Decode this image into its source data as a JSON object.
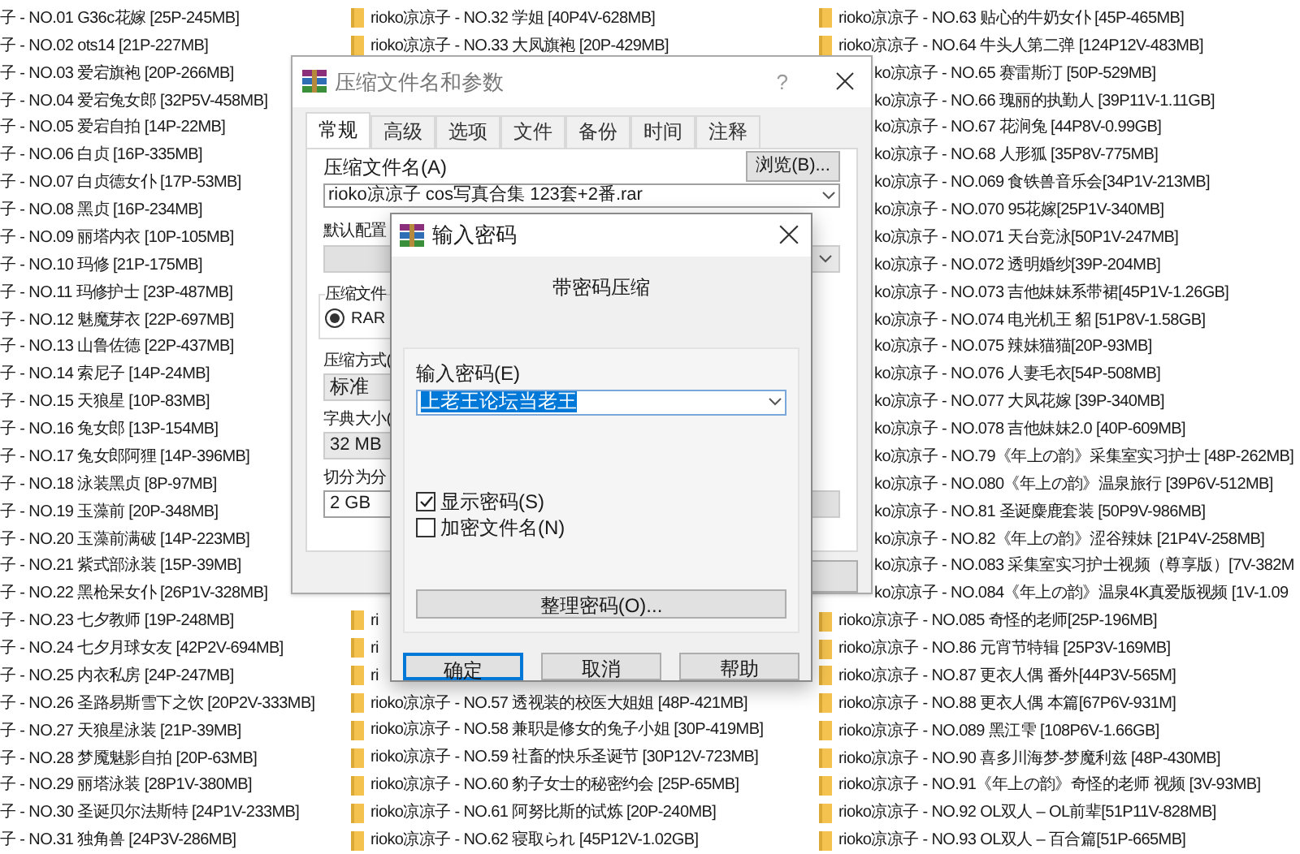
{
  "file_list": {
    "column_1": [
      "子 - NO.01 G36c花嫁 [25P-245MB]",
      "子 - NO.02 ots14 [21P-227MB]",
      "子 - NO.03 爱宕旗袍 [20P-266MB]",
      "子 - NO.04 爱宕兔女郎 [32P5V-458MB]",
      "子 - NO.05 爱宕自拍 [14P-22MB]",
      "子 - NO.06 白贞 [16P-335MB]",
      "子 - NO.07 白贞德女仆 [17P-53MB]",
      "子 - NO.08 黑贞 [16P-234MB]",
      "子 - NO.09 丽塔内衣 [10P-105MB]",
      "子 - NO.10 玛修 [21P-175MB]",
      "子 - NO.11 玛修护士 [23P-487MB]",
      "子 - NO.12 魅魔芽衣 [22P-697MB]",
      "子 - NO.13 山鲁佐德 [22P-437MB]",
      "子 - NO.14 索尼子 [14P-24MB]",
      "子 - NO.15 天狼星 [10P-83MB]",
      "子 - NO.16 兔女郎 [13P-154MB]",
      "子 - NO.17 兔女郎阿狸 [14P-396MB]",
      "子 - NO.18 泳装黑贞 [8P-97MB]",
      "子 - NO.19 玉藻前 [20P-348MB]",
      "子 - NO.20 玉藻前满破 [14P-223MB]",
      "子 - NO.21 紫式部泳装 [15P-39MB]",
      "子 - NO.22 黑枪呆女仆 [26P1V-328MB]",
      "子 - NO.23 七夕教师 [19P-248MB]",
      "子 - NO.24 七夕月球女友 [42P2V-694MB]",
      "子 - NO.25 内衣私房 [24P-247MB]",
      "子 - NO.26 圣路易斯雪下之饮 [20P2V-333MB]",
      "子 - NO.27 天狼星泳装 [21P-39MB]",
      "子 - NO.28 梦魇魅影自拍 [20P-63MB]",
      "子 - NO.29 丽塔泳装 [28P1V-380MB]",
      "子 - NO.30 圣诞贝尔法斯特 [24P1V-233MB]",
      "子 - NO.31 独角兽 [24P3V-286MB]"
    ],
    "column_2": {
      "top": [
        "rioko凉凉子 - NO.32 学姐 [40P4V-628MB]",
        "rioko凉凉子 - NO.33 大凤旗袍 [20P-429MB]"
      ],
      "bottom": [
        "ri",
        "ri",
        "ri",
        "rioko凉凉子 - NO.57 透视装的校医大姐姐 [48P-421MB]",
        "rioko凉凉子 - NO.58 兼职是修女的兔子小姐 [30P-419MB]",
        "rioko凉凉子 - NO.59 社畜的快乐圣诞节 [30P12V-723MB]",
        "rioko凉凉子 - NO.60 豹子女士的秘密约会 [25P-65MB]",
        "rioko凉凉子 - NO.61 阿努比斯的试炼 [20P-240MB]",
        "rioko凉凉子 - NO.62 寝取られ [45P12V-1.02GB]"
      ]
    },
    "column_3": [
      {
        "kind": "full",
        "name": "rioko凉凉子 - NO.63 贴心的牛奶女仆 [45P-465MB]"
      },
      {
        "kind": "full",
        "name": "rioko凉凉子 - NO.64 牛头人第二弹 [124P12V-483MB]"
      },
      {
        "kind": "cut",
        "name": "ko凉凉子 - NO.65 赛雷斯汀 [50P-529MB]"
      },
      {
        "kind": "cut",
        "name": "ko凉凉子 - NO.66 瑰丽的执勤人 [39P11V-1.11GB]"
      },
      {
        "kind": "cut",
        "name": "ko凉凉子 - NO.67 花涧兔 [44P8V-0.99GB]"
      },
      {
        "kind": "cut",
        "name": "ko凉凉子 - NO.68 人形狐 [35P8V-775MB]"
      },
      {
        "kind": "cut",
        "name": "ko凉凉子 - NO.069 食铁兽音乐会[34P1V-213MB]"
      },
      {
        "kind": "cut",
        "name": "ko凉凉子 - NO.070 95花嫁[25P1V-340MB]"
      },
      {
        "kind": "cut",
        "name": "ko凉凉子 - NO.071 天台竞泳[50P1V-247MB]"
      },
      {
        "kind": "cut",
        "name": "ko凉凉子 - NO.072 透明婚纱[39P-204MB]"
      },
      {
        "kind": "cut",
        "name": "ko凉凉子 - NO.073 吉他妹妹系带裙[45P1V-1.26GB]"
      },
      {
        "kind": "cut",
        "name": "ko凉凉子 - NO.074 电光机王 貂 [51P8V-1.58GB]"
      },
      {
        "kind": "cut",
        "name": "ko凉凉子 - NO.075 辣妹猫猫[20P-93MB]"
      },
      {
        "kind": "cut",
        "name": "ko凉凉子 - NO.076 人妻毛衣[54P-508MB]"
      },
      {
        "kind": "cut",
        "name": "ko凉凉子 - NO.077 大凤花嫁 [39P-340MB]"
      },
      {
        "kind": "cut",
        "name": "ko凉凉子 - NO.078 吉他妹妹2.0 [40P-609MB]"
      },
      {
        "kind": "cut",
        "name": "ko凉凉子 - NO.79《年上の韵》采集室实习护士 [48P-262MB]"
      },
      {
        "kind": "cut",
        "name": "ko凉凉子 - NO.080《年上の韵》温泉旅行 [39P6V-512MB]"
      },
      {
        "kind": "cut",
        "name": "ko凉凉子 - NO.81 圣诞麋鹿套装 [50P9V-986MB]"
      },
      {
        "kind": "cut",
        "name": "ko凉凉子 - NO.82《年上の韵》涩谷辣妹 [21P4V-258MB]"
      },
      {
        "kind": "cut",
        "name": "ko凉凉子 - NO.083 采集室实习护士视频（尊享版）[7V-382M"
      },
      {
        "kind": "cut",
        "name": "ko凉凉子 - NO.084《年上の韵》温泉4K真爱版视频 [1V-1.09"
      },
      {
        "kind": "full",
        "name": "rioko凉凉子 - NO.085 奇怪的老师[25P-196MB]"
      },
      {
        "kind": "full",
        "name": "rioko凉凉子 - NO.86 元宵节特辑 [25P3V-169MB]"
      },
      {
        "kind": "full",
        "name": "rioko凉凉子 - NO.87 更衣人偶 番外[44P3V-565M]"
      },
      {
        "kind": "full",
        "name": "rioko凉凉子 - NO.88 更衣人偶 本篇[67P6V-931M]"
      },
      {
        "kind": "full",
        "name": "rioko凉凉子 - NO.089 黑江雫 [108P6V-1.66GB]"
      },
      {
        "kind": "full",
        "name": "rioko凉凉子 - NO.90 喜多川海梦-梦魔利兹 [48P-430MB]"
      },
      {
        "kind": "full",
        "name": "rioko凉凉子 - NO.91《年上の韵》奇怪的老师 视频 [3V-93MB]"
      },
      {
        "kind": "full",
        "name": "rioko凉凉子 - NO.92 OL双人 – OL前辈[51P11V-828MB]"
      },
      {
        "kind": "full",
        "name": "rioko凉凉子 - NO.93 OL双人 – 百合篇[51P-665MB]"
      }
    ]
  },
  "archive_dialog": {
    "title": "压缩文件名和参数",
    "help_mark": "?",
    "tabs": [
      {
        "label": "常规",
        "selected": true
      },
      {
        "label": "高级",
        "selected": false
      },
      {
        "label": "选项",
        "selected": false
      },
      {
        "label": "文件",
        "selected": false
      },
      {
        "label": "备份",
        "selected": false
      },
      {
        "label": "时间",
        "selected": false
      },
      {
        "label": "注释",
        "selected": false
      }
    ],
    "archive_name_label": "压缩文件名(A)",
    "browse_button": "浏览(B)...",
    "archive_name": "rioko凉凉子 cos写真合集 123套+2番.rar",
    "profile_label": "默认配置",
    "format_group_label": "压缩文件",
    "format_option": {
      "label": "RAR",
      "selected": true
    },
    "method_label": "压缩方式(",
    "method": "标准",
    "dictionary_label": "字典大小(",
    "dictionary": "32 MB",
    "split_label": "切分为分",
    "split": "2 GB"
  },
  "password_dialog": {
    "title": "输入密码",
    "heading": "带密码压缩",
    "password_label": "输入密码(E)",
    "password": "上老王论坛当老王",
    "password_selected": true,
    "options": [
      {
        "label": "显示密码(S)",
        "checked": true
      },
      {
        "label": "加密文件名(N)",
        "checked": false
      }
    ],
    "organize_button": "整理密码(O)...",
    "buttons": [
      {
        "label": "确定",
        "focused": true
      },
      {
        "label": "取消",
        "focused": false
      },
      {
        "label": "帮助",
        "focused": false
      }
    ]
  }
}
